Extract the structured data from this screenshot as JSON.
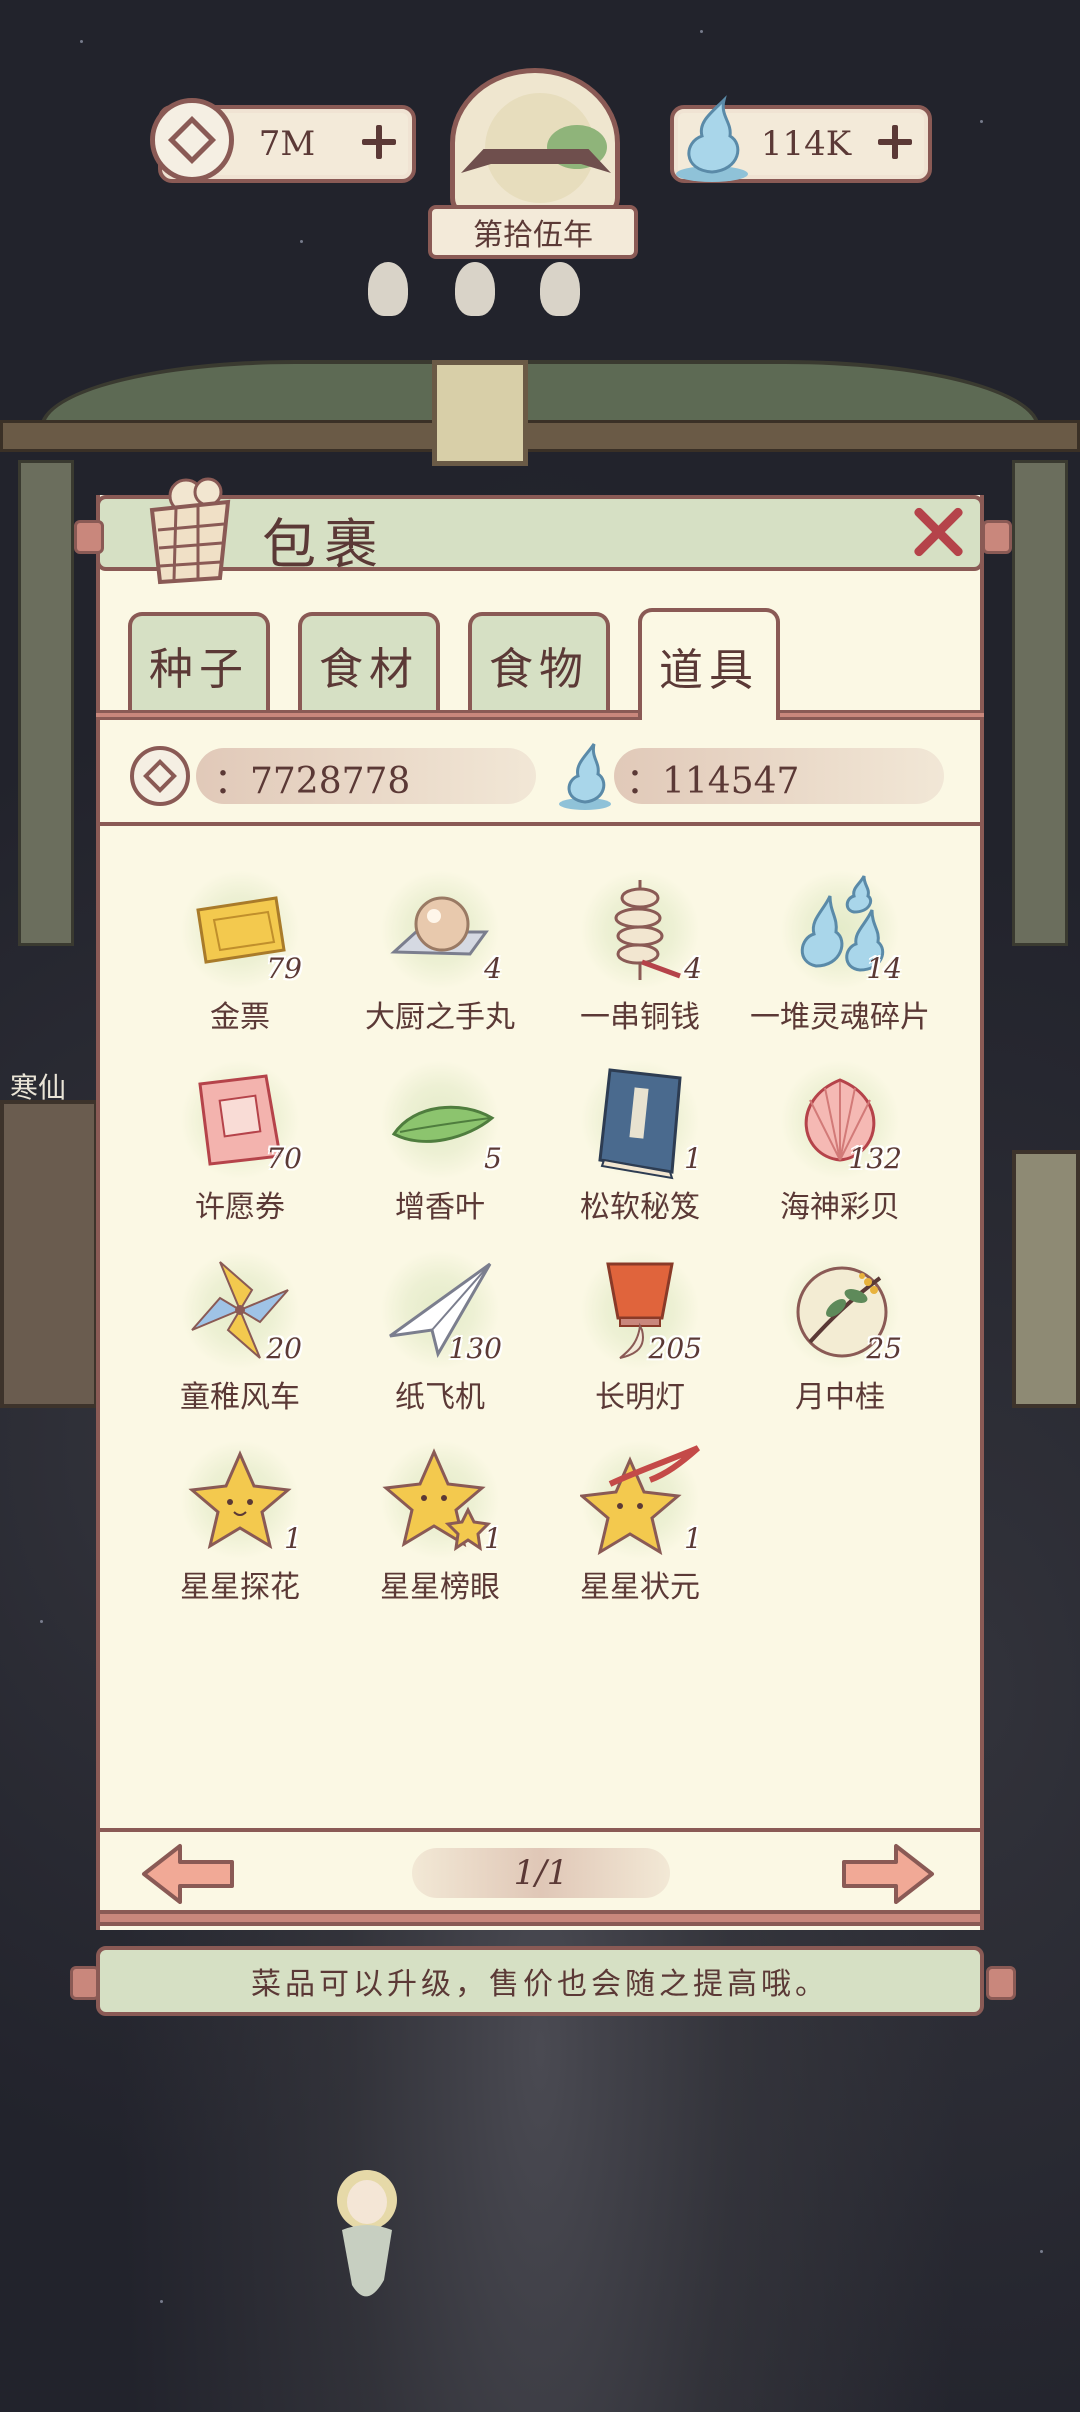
{
  "top_bar": {
    "coins": "7M",
    "souls": "114K",
    "year": "第拾伍年"
  },
  "panel": {
    "title": "包裹",
    "tabs": [
      "种子",
      "食材",
      "食物",
      "道具"
    ],
    "active_tab": "道具",
    "coin_amount": "：7728778",
    "soul_amount": "：114547"
  },
  "items": [
    {
      "name": "金票",
      "count": "79",
      "icon": "gold-ticket-icon"
    },
    {
      "name": "大厨之手丸",
      "count": "4",
      "icon": "pearl-icon"
    },
    {
      "name": "一串铜钱",
      "count": "4",
      "icon": "copper-coins-icon"
    },
    {
      "name": "一堆灵魂碎片",
      "count": "14",
      "icon": "soul-fragments-icon"
    },
    {
      "name": "许愿券",
      "count": "70",
      "icon": "wish-ticket-icon"
    },
    {
      "name": "增香叶",
      "count": "5",
      "icon": "leaf-icon"
    },
    {
      "name": "松软秘笈",
      "count": "1",
      "icon": "book-icon"
    },
    {
      "name": "海神彩贝",
      "count": "132",
      "icon": "shell-icon"
    },
    {
      "name": "童稚风车",
      "count": "20",
      "icon": "pinwheel-icon"
    },
    {
      "name": "纸飞机",
      "count": "130",
      "icon": "paper-plane-icon"
    },
    {
      "name": "长明灯",
      "count": "205",
      "icon": "sky-lantern-icon"
    },
    {
      "name": "月中桂",
      "count": "25",
      "icon": "osmanthus-moon-icon"
    },
    {
      "name": "星星探花",
      "count": "1",
      "icon": "star-icon"
    },
    {
      "name": "星星榜眼",
      "count": "1",
      "icon": "double-star-icon"
    },
    {
      "name": "星星状元",
      "count": "1",
      "icon": "star-ribbon-icon"
    }
  ],
  "pager": {
    "page": "1/1"
  },
  "tip": "菜品可以升级，售价也会随之提高哦。",
  "side_label": "寒仙",
  "colors": {
    "frame": "#8a5a55",
    "paper": "#fbf8e4",
    "sage": "#d6e0c4",
    "text": "#5b3936",
    "close": "#b5434a"
  }
}
